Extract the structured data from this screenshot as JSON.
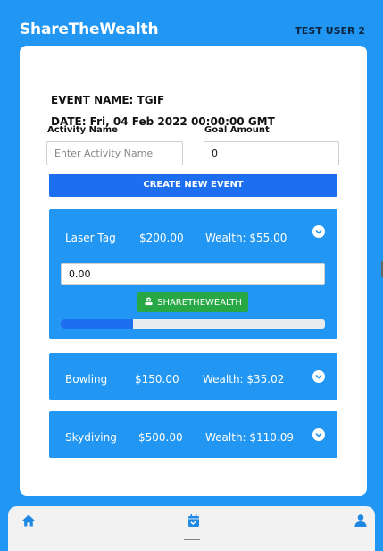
{
  "header": {
    "app_title": "ShareTheWealth",
    "user_name": "TEST USER 2"
  },
  "event": {
    "name_line": "EVENT NAME: TGIF",
    "date_line": "DATE: Fri, 04 Feb 2022 00:00:00 GMT"
  },
  "form": {
    "activity_label": "Activity Name",
    "activity_placeholder": "Enter Activity Name",
    "goal_label": "Goal Amount",
    "goal_value": "0",
    "create_button": "CREATE NEW EVENT"
  },
  "activities": [
    {
      "name": "Laser Tag",
      "goal": "$200.00",
      "wealth": "Wealth:  $55.00",
      "expanded": true,
      "amount_value": "0.00",
      "share_label": "SHARETHEWEALTH",
      "progress": 0.275
    },
    {
      "name": "Bowling",
      "goal": "$150.00",
      "wealth": "Wealth:  $35.02",
      "expanded": false
    },
    {
      "name": "Skydiving",
      "goal": "$500.00",
      "wealth": "Wealth:  $110.09",
      "expanded": false
    }
  ],
  "nav": {
    "items": [
      "home-icon",
      "calendar-check-icon",
      "user-icon"
    ]
  },
  "colors": {
    "primary": "#2196f3",
    "button_blue": "#1e6ff0",
    "share_green": "#28a745"
  }
}
